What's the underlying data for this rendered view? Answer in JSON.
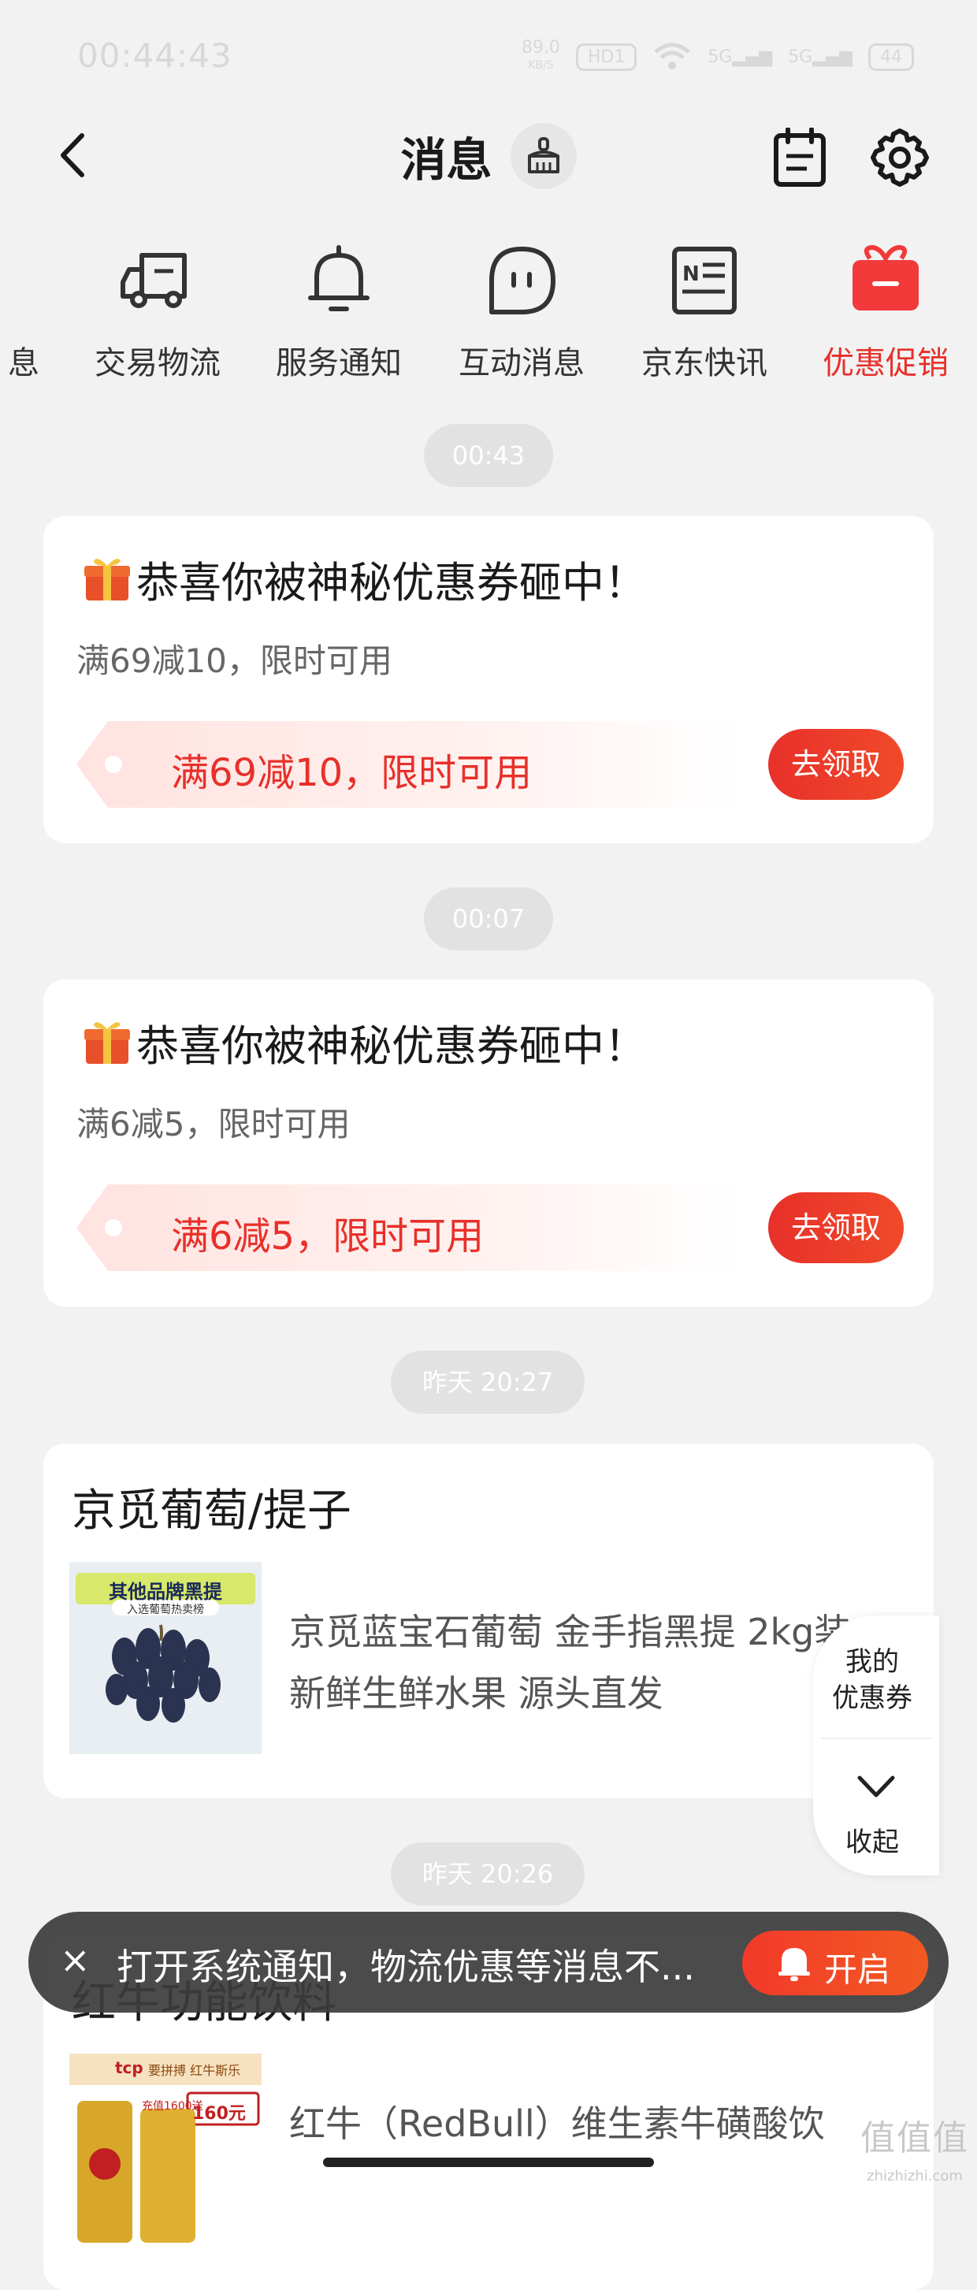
{
  "status_bar": {
    "time": "00:44:43",
    "net_speed_value": "89.0",
    "net_speed_unit": "KB/S",
    "hd": "HD1",
    "sim1": "5G",
    "sim2": "5G",
    "battery": "44"
  },
  "header": {
    "title": "消息"
  },
  "categories": {
    "partial_label": "息",
    "items": [
      {
        "label": "交易物流",
        "icon": "truck-icon"
      },
      {
        "label": "服务通知",
        "icon": "bell-icon"
      },
      {
        "label": "互动消息",
        "icon": "chat-icon"
      },
      {
        "label": "京东快讯",
        "icon": "news-icon"
      },
      {
        "label": "优惠促销",
        "icon": "gift-icon",
        "active": true
      }
    ]
  },
  "messages": [
    {
      "time": "00:43",
      "type": "coupon",
      "title": "恭喜你被神秘优惠券砸中！",
      "subtitle": "满69减10，限时可用",
      "band": "满69减10，限时可用",
      "button": "去领取"
    },
    {
      "time": "00:07",
      "type": "coupon",
      "title": "恭喜你被神秘优惠券砸中！",
      "subtitle": "满6减5，限时可用",
      "band": "满6减5，限时可用",
      "button": "去领取"
    },
    {
      "time": "昨天 20:27",
      "type": "product",
      "title": "京觅葡萄/提子",
      "image_banner": "其他品牌黑提",
      "image_sub": "入选葡萄热卖榜",
      "desc": "京觅蓝宝石葡萄 金手指黑提 2kg装 新鲜生鲜水果 源头直发"
    },
    {
      "time": "昨天 20:26",
      "type": "product",
      "title": "红牛功能饮料",
      "image_banner": "要拼搏 红牛斯乐",
      "image_sub": "充值1600送",
      "image_price": "160元",
      "image_logo": "tcp",
      "desc": "红牛（RedBull）维生素牛磺酸饮"
    }
  ],
  "float_panel": {
    "top_line1": "我的",
    "top_line2": "优惠券",
    "bottom": "收起"
  },
  "toast": {
    "close": "×",
    "text": "打开系统通知，物流优惠等消息不...",
    "button": "开启"
  },
  "watermark": {
    "chars": "值值值",
    "url": "zhizhizhi.com"
  },
  "colors": {
    "accent": "#e8302a",
    "background": "#f2f2f2",
    "time_pill": "#e2e2e2"
  }
}
